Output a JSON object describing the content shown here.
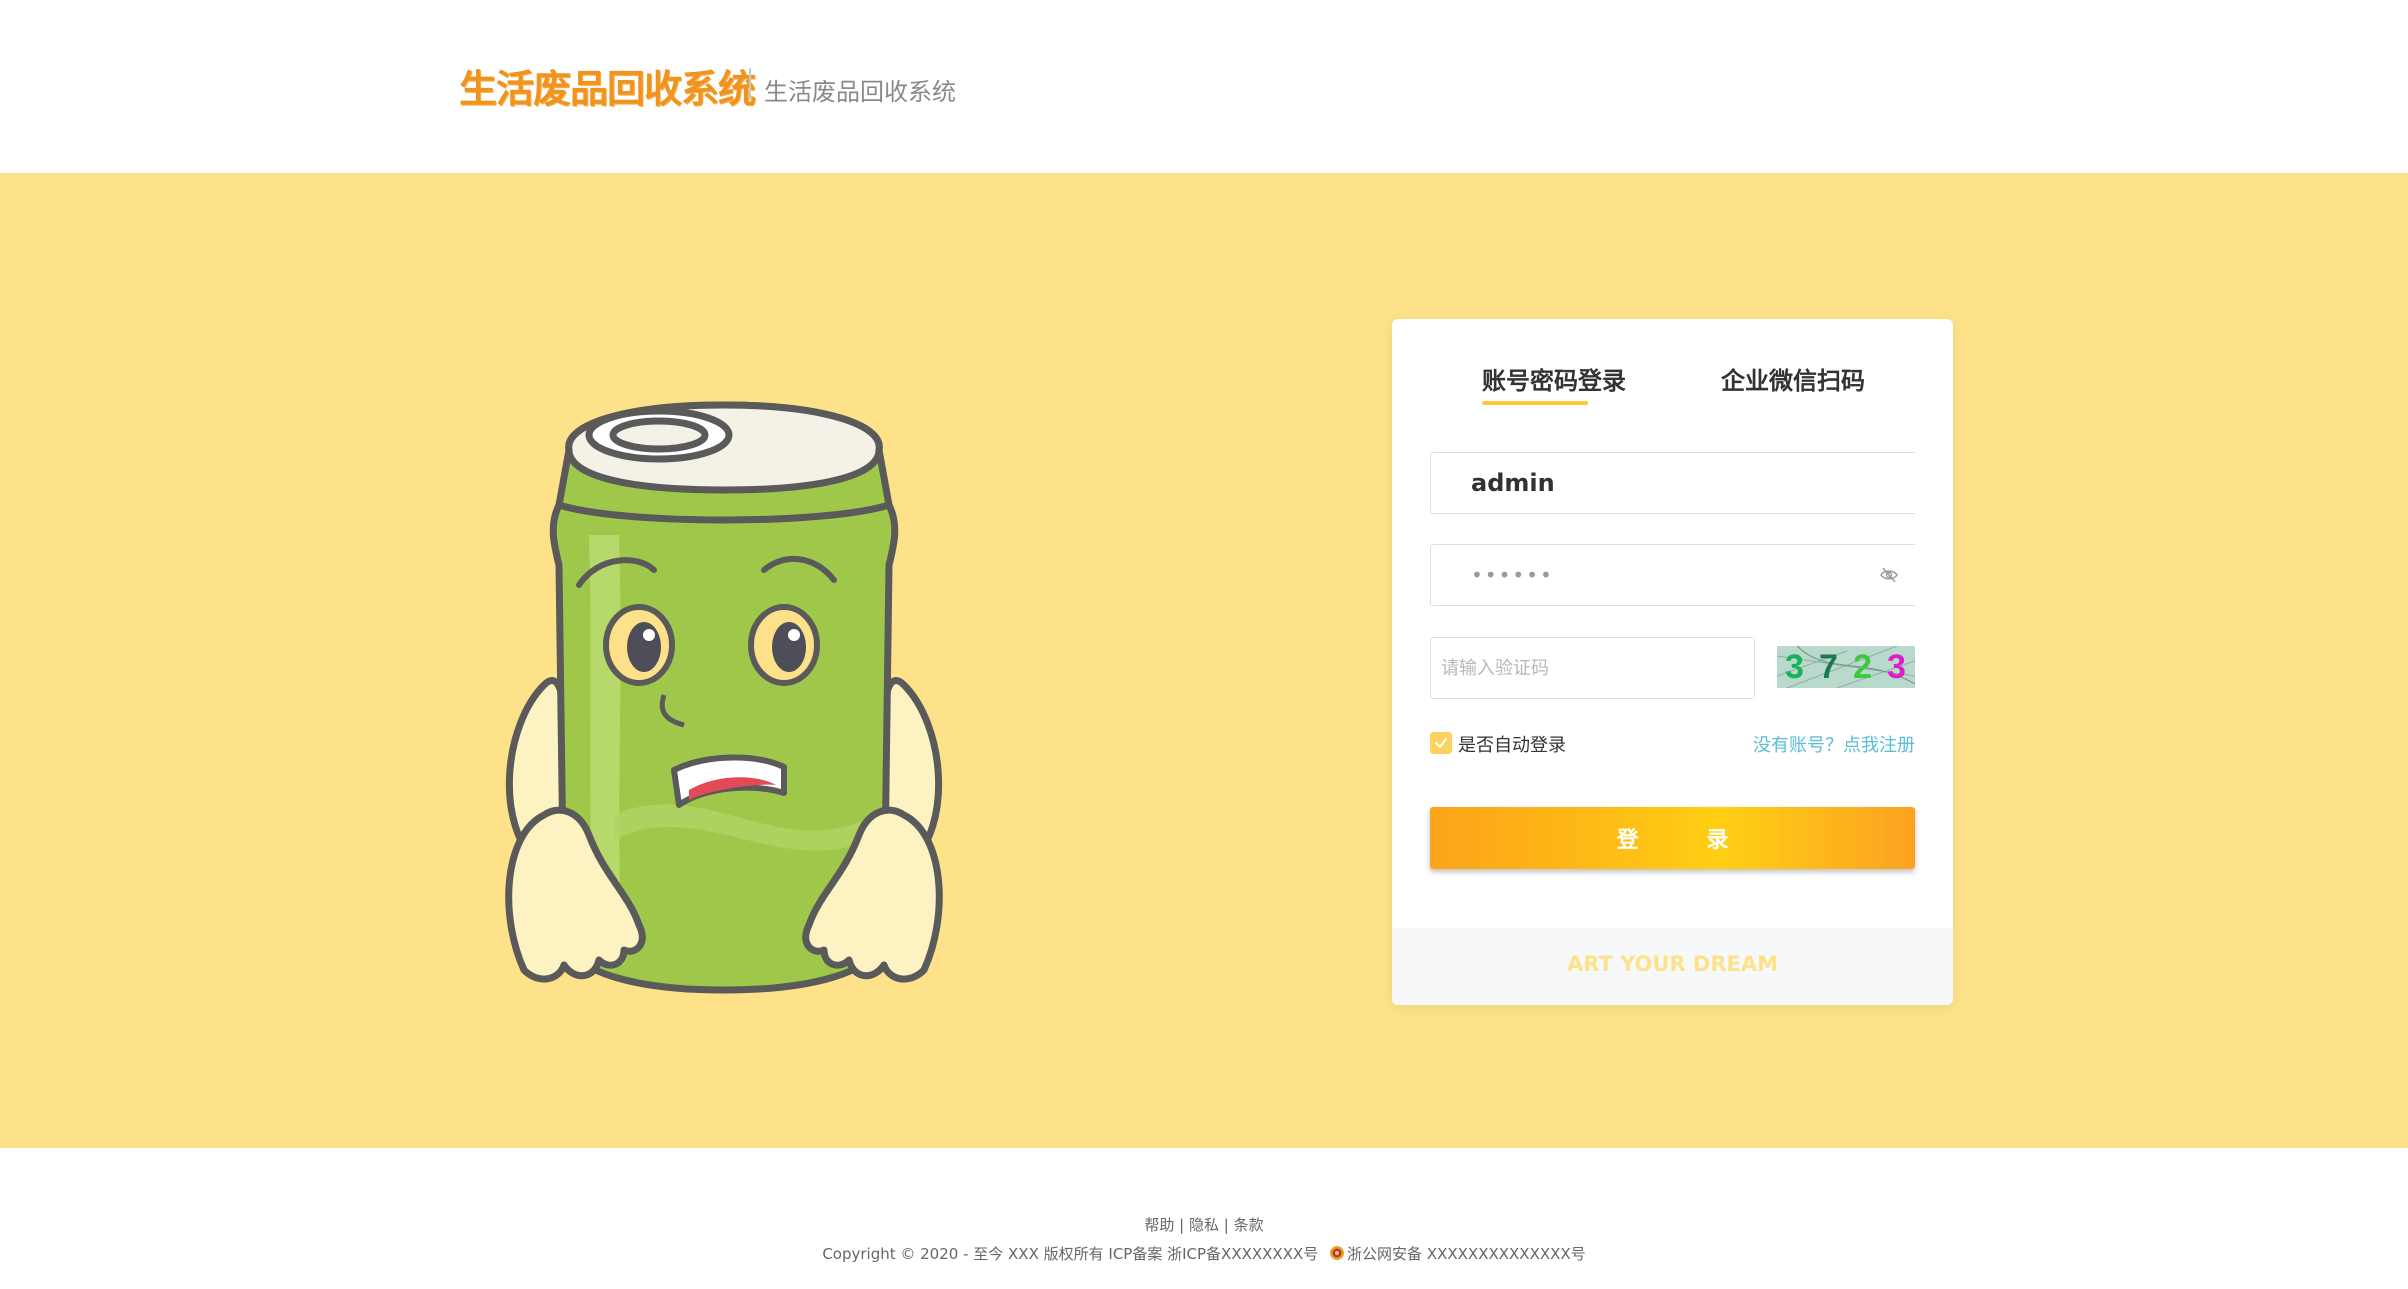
{
  "header": {
    "logo_text": "生活废品回收系统",
    "subtitle": "生活废品回收系统"
  },
  "login": {
    "tabs": [
      {
        "label": "账号密码登录",
        "active": true
      },
      {
        "label": "企业微信扫码",
        "active": false
      }
    ],
    "username_value": "admin",
    "password_value": "••••••",
    "captcha_placeholder": "请输入验证码",
    "captcha_code": [
      "3",
      "7",
      "2",
      "3"
    ],
    "remember_label": "是否自动登录",
    "remember_checked": true,
    "register_link": "没有账号？点我注册",
    "login_button": "登 录",
    "slogan": "ART YOUR DREAM"
  },
  "footer": {
    "links": [
      "帮助",
      "隐私",
      "条款"
    ],
    "separator": "|",
    "copyright": "Copyright © 2020 - 至今 XXX 版权所有 ICP备案 浙ICP备XXXXXXXX号",
    "police": "浙公网安备 XXXXXXXXXXXXXX号"
  },
  "colors": {
    "brand_orange": "#f0941f",
    "hero_background": "#fee289",
    "tab_underline": "#fdca36",
    "link_blue": "#5bbcd8"
  },
  "icons": [
    "eye-off-icon",
    "check-icon",
    "police-badge-icon"
  ],
  "illustration": "green-soda-can-mascot"
}
